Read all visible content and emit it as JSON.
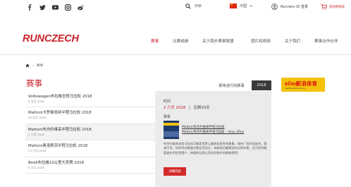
{
  "topbar": {
    "social_icons": [
      "facebook-icon",
      "twitter-icon",
      "youtube-icon",
      "instagram-icon",
      "weibo-icon"
    ],
    "search_placeholder": "搜索",
    "language": "中国",
    "login": "Runners ID 登录",
    "cart": "您的购物车"
  },
  "header": {
    "logo": "RUNCZECH",
    "nav": [
      "赛事",
      "比赛成绩",
      "关于跑步赛事联盟",
      "图片和视频",
      "关于我们",
      "赛事合作伙伴"
    ]
  },
  "breadcrumb": {
    "home_icon": "home-icon",
    "current": "赛事"
  },
  "page_title": "赛事",
  "tabs": {
    "current": "即将进行的赛事",
    "year": "2018"
  },
  "sponsor": {
    "name_latin": "sina",
    "name_cn": "新浪体育",
    "url": "sports.sina.com.cn"
  },
  "events": [
    {
      "name": "Volkswagen布拉格全程马拉松 2018",
      "date": "6 五月 2018"
    },
    {
      "name": "Mattoni卡罗维发利半程马拉松 2018",
      "date": "19 五月 2018"
    },
    {
      "name": "Mattoni布杰约维采半程马拉松 2018",
      "date": "2 六月 2018"
    },
    {
      "name": "Mattoni奥洛穆茨半程马拉松 2018",
      "date": "23 六月 2018"
    },
    {
      "name": "Birell布拉格10公里大奖赛 2018",
      "date": "8 九月 2018"
    }
  ],
  "detail": {
    "time_label": "时间",
    "date": "2 六月 2018",
    "separator": "|",
    "duration": "还剩30天",
    "events_label": "赛事",
    "links": [
      "Mattoni布杰约维采半程马拉松",
      "Mattoni布杰约维采半程马拉松 - relay 2Run"
    ],
    "description": "布杰约维采半程马拉松可能是世界上最具标签性的赛事，城市广场开阔宏伟，赛道平坦，如同举办最盛大聚会而设计，穿越周边最美丽的自然风景，还可欣赏最富盛名的世界遗产，快速的比赛让您体验跑步的最美感受！",
    "button": "详细内容"
  }
}
